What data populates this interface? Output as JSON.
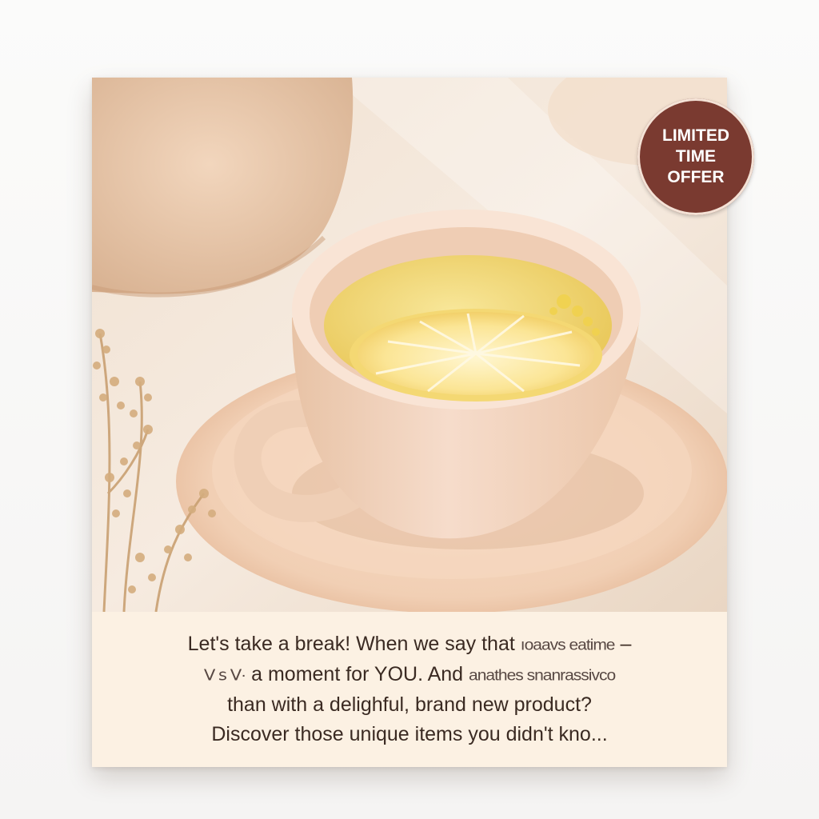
{
  "badge": {
    "lines": [
      "LIMITED",
      "TIME",
      "OFFER"
    ],
    "color": "#7a3a30"
  },
  "caption": {
    "line1_text": "Let's take a break! When we say that",
    "line1_garbled": "ıoaavs eatime",
    "line1_end": "–",
    "line2_garbled_start": "ᐯ ꜱ ᐯ·",
    "line2_text": "a moment for YOU. And",
    "line2_garbled_end": "anathes snanrassivco",
    "line3": "than with a delighful, brand new product?",
    "line4": "Discover those unique items you didn't kno..."
  },
  "photo": {
    "subject": "lemon-tea-cup-icon",
    "palette": {
      "background": "#efe2d4",
      "cup": "#f2d2b8",
      "tea": "#f3dc7a",
      "lemon": "#fbe8a0"
    }
  }
}
